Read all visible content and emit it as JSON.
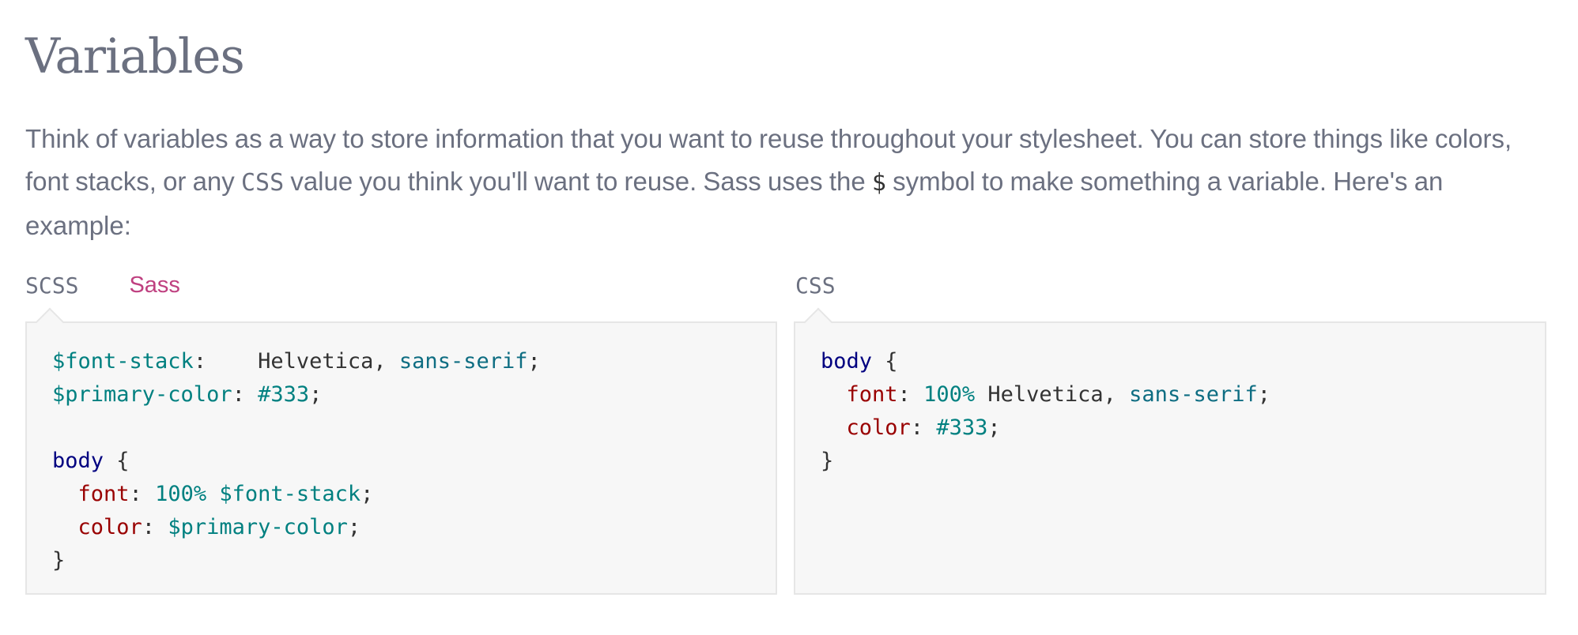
{
  "section": {
    "title": "Variables",
    "intro": {
      "part1": "Think of variables as a way to store information that you want to reuse throughout your stylesheet. You can store things like colors, font stacks, or any ",
      "code1": "CSS",
      "part2": " value you think you'll want to reuse. Sass uses the ",
      "code2": "$",
      "part3": " symbol to make something a variable. Here's an example:"
    }
  },
  "tabs_left": [
    {
      "label": "SCSS",
      "active": true
    },
    {
      "label": "Sass",
      "active": false
    }
  ],
  "tabs_right": [
    {
      "label": "CSS",
      "active": true
    }
  ],
  "scss_code": {
    "l1": {
      "var": "$font-stack",
      "colon": ":",
      "val1": "    Helvetica, ",
      "val2": "sans-serif",
      "semi": ";"
    },
    "l2": {
      "var": "$primary-color",
      "colon": ": ",
      "val": "#333",
      "semi": ";"
    },
    "l4": {
      "sel": "body",
      "brace": " {"
    },
    "l5": {
      "prop": "font",
      "colon": ": ",
      "num": "100%",
      "sp": " ",
      "var": "$font-stack",
      "semi": ";"
    },
    "l6": {
      "prop": "color",
      "colon": ": ",
      "var": "$primary-color",
      "semi": ";"
    },
    "l7": {
      "brace": "}"
    }
  },
  "css_code": {
    "l1": {
      "sel": "body",
      "brace": " {"
    },
    "l2": {
      "prop": "font",
      "colon": ": ",
      "num": "100%",
      "val1": " Helvetica, ",
      "val2": "sans-serif",
      "semi": ";"
    },
    "l3": {
      "prop": "color",
      "colon": ": ",
      "val": "#333",
      "semi": ";"
    },
    "l4": {
      "brace": "}"
    }
  },
  "colors": {
    "text": "#6b7080",
    "accent": "#bf4080",
    "code_bg": "#f7f7f7",
    "code_border": "#e6e6e6"
  }
}
